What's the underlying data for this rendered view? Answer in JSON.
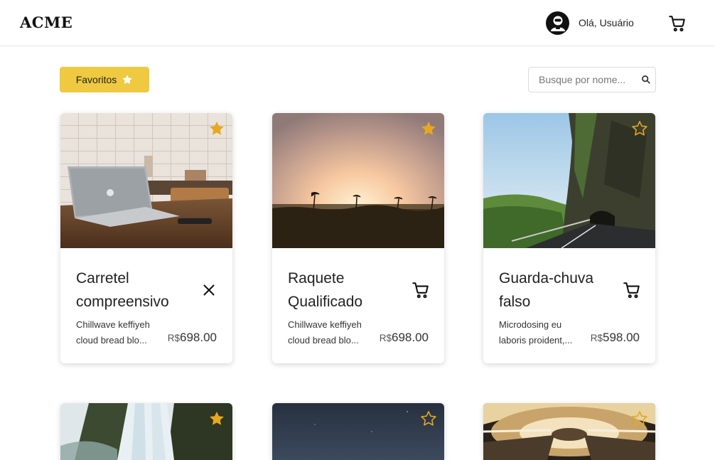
{
  "header": {
    "logo": "ACME",
    "greeting": "Olá, Usuário",
    "avatar_icon": "user-avatar-icon",
    "cart_icon": "cart-icon"
  },
  "toolbar": {
    "favorites_label": "Favoritos",
    "search_placeholder": "Busque por nome...",
    "search_icon": "search-icon"
  },
  "colors": {
    "accent": "#efc940",
    "star": "#e5a820"
  },
  "products": [
    {
      "title_line1": "Carretel",
      "title_line2": "compreensivo",
      "desc_line1": "Chillwave keffiyeh",
      "desc_line2": "cloud bread blo...",
      "currency": "R$",
      "price": "698.00",
      "favorite": true,
      "action_icon": "close-icon"
    },
    {
      "title_line1": "Raquete",
      "title_line2": "Qualificado",
      "desc_line1": "Chillwave keffiyeh",
      "desc_line2": "cloud bread blo...",
      "currency": "R$",
      "price": "698.00",
      "favorite": true,
      "action_icon": "cart-icon"
    },
    {
      "title_line1": "Guarda-chuva",
      "title_line2": "falso",
      "desc_line1": "Microdosing eu",
      "desc_line2": "laboris proident,...",
      "currency": "R$",
      "price": "598.00",
      "favorite": false,
      "action_icon": "cart-icon"
    },
    {
      "favorite": true
    },
    {
      "favorite": false
    },
    {
      "favorite": false
    }
  ]
}
